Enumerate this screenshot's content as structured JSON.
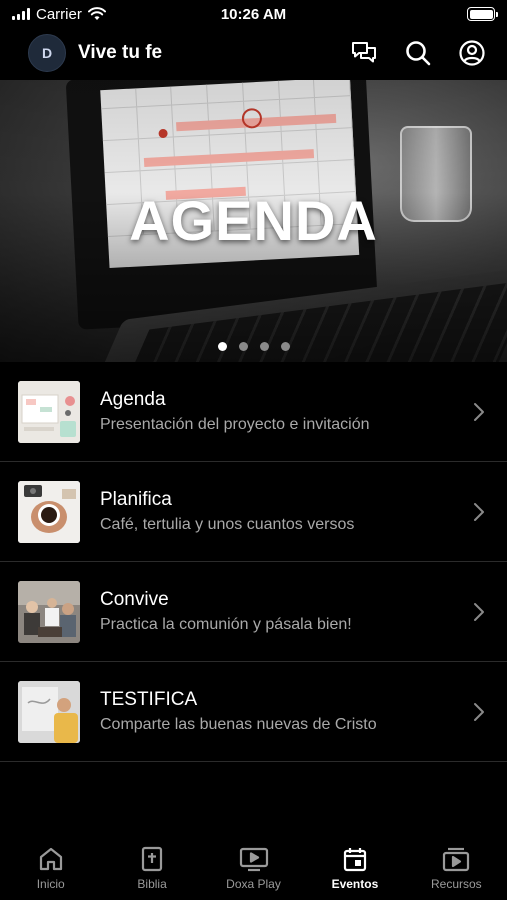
{
  "status_bar": {
    "carrier": "Carrier",
    "time": "10:26 AM"
  },
  "header": {
    "logo_letter": "D",
    "title": "Vive tu fe",
    "icons": [
      "chat-icon",
      "search-icon",
      "profile-icon"
    ]
  },
  "hero": {
    "title": "AGENDA",
    "pages": 4,
    "active_page": 1
  },
  "list": {
    "items": [
      {
        "title": "Agenda",
        "subtitle": "Presentación del proyecto e invitación"
      },
      {
        "title": "Planifica",
        "subtitle": "Café, tertulia y unos cuantos versos"
      },
      {
        "title": "Convive",
        "subtitle": "Practica la comunión y pásala bien!"
      },
      {
        "title": "TESTIFICA",
        "subtitle": "Comparte las buenas nuevas de Cristo"
      }
    ]
  },
  "tabbar": {
    "tabs": [
      {
        "label": "Inicio",
        "icon": "home-icon"
      },
      {
        "label": "Biblia",
        "icon": "bible-icon"
      },
      {
        "label": "Doxa Play",
        "icon": "play-icon"
      },
      {
        "label": "Eventos",
        "icon": "calendar-icon"
      },
      {
        "label": "Recursos",
        "icon": "resources-icon"
      }
    ],
    "active": "Eventos"
  },
  "colors": {
    "background": "#000000",
    "text_primary": "#ffffff",
    "text_secondary": "#a9a9a9",
    "separator": "#2b2b2b",
    "tab_inactive": "#9a9a9a"
  }
}
